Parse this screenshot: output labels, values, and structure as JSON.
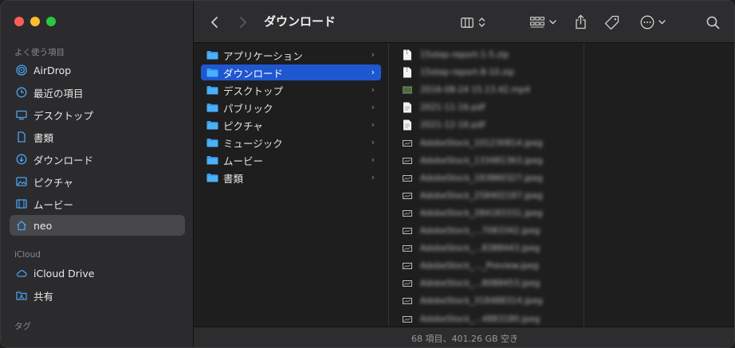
{
  "window": {
    "title": "ダウンロード",
    "status": "68 項目、401.26 GB 空き"
  },
  "colors": {
    "close": "#ff5f57",
    "minimize": "#febc2e",
    "zoom": "#28c840",
    "accent": "#1f57d1",
    "folder": "#3aa0f0"
  },
  "sidebar": {
    "favorites_title": "よく使う項目",
    "favorites": [
      {
        "label": "AirDrop",
        "icon": "airdrop-icon"
      },
      {
        "label": "最近の項目",
        "icon": "clock-icon"
      },
      {
        "label": "デスクトップ",
        "icon": "desktop-icon"
      },
      {
        "label": "書類",
        "icon": "document-icon"
      },
      {
        "label": "ダウンロード",
        "icon": "download-icon"
      },
      {
        "label": "ピクチャ",
        "icon": "photo-icon"
      },
      {
        "label": "ムービー",
        "icon": "film-icon"
      },
      {
        "label": "neo",
        "icon": "home-icon"
      }
    ],
    "icloud_title": "iCloud",
    "icloud": [
      {
        "label": "iCloud Drive",
        "icon": "cloud-icon"
      },
      {
        "label": "共有",
        "icon": "shared-folder-icon"
      }
    ],
    "tags_title": "タグ"
  },
  "column1": [
    {
      "label": "アプリケーション"
    },
    {
      "label": "ダウンロード"
    },
    {
      "label": "デスクトップ"
    },
    {
      "label": "パブリック"
    },
    {
      "label": "ピクチャ"
    },
    {
      "label": "ミュージック"
    },
    {
      "label": "ムービー"
    },
    {
      "label": "書類"
    }
  ],
  "column2": [
    {
      "label": "15step-report-1-5.zip",
      "kind": "zip"
    },
    {
      "label": "15step-report-8-10.zip",
      "kind": "zip"
    },
    {
      "label": "2016-08-24 15.13.42.mp4",
      "kind": "video"
    },
    {
      "label": "2021-11-16.pdf",
      "kind": "pdf"
    },
    {
      "label": "2021-12-16.pdf",
      "kind": "pdf"
    },
    {
      "label": "AdobeStock_101230814.jpeg",
      "kind": "img"
    },
    {
      "label": "AdobeStock_133481363.jpeg",
      "kind": "img"
    },
    {
      "label": "AdobeStock_183860327.jpeg",
      "kind": "img"
    },
    {
      "label": "AdobeStock_258402187.jpeg",
      "kind": "img"
    },
    {
      "label": "AdobeStock_284183331.jpeg",
      "kind": "img"
    },
    {
      "label": "AdobeStock_...7083342.jpeg",
      "kind": "img"
    },
    {
      "label": "AdobeStock_...8388443.jpeg",
      "kind": "img"
    },
    {
      "label": "AdobeStock_..._Preview.jpeg",
      "kind": "img"
    },
    {
      "label": "AdobeStock_...8088453.jpeg",
      "kind": "img"
    },
    {
      "label": "AdobeStock_318488314.jpeg",
      "kind": "img"
    },
    {
      "label": "AdobeStock_...4883180.jpeg",
      "kind": "img"
    }
  ]
}
